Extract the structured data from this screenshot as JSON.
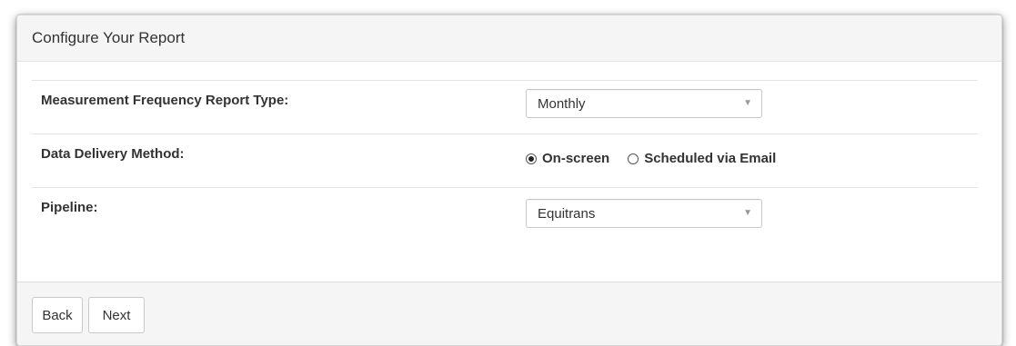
{
  "panel": {
    "title": "Configure Your Report"
  },
  "fields": {
    "report_type": {
      "label": "Measurement Frequency Report Type:",
      "selected": "Monthly"
    },
    "delivery_method": {
      "label": "Data Delivery Method:",
      "options": [
        {
          "label": "On-screen",
          "checked": true
        },
        {
          "label": "Scheduled via Email",
          "checked": false
        }
      ]
    },
    "pipeline": {
      "label": "Pipeline:",
      "selected": "Equitrans"
    }
  },
  "footer": {
    "back_label": "Back",
    "next_label": "Next"
  },
  "icons": {
    "dropdown": "chevron-down-icon",
    "radio_checked": "radio-checked-icon",
    "radio_unchecked": "radio-unchecked-icon"
  }
}
